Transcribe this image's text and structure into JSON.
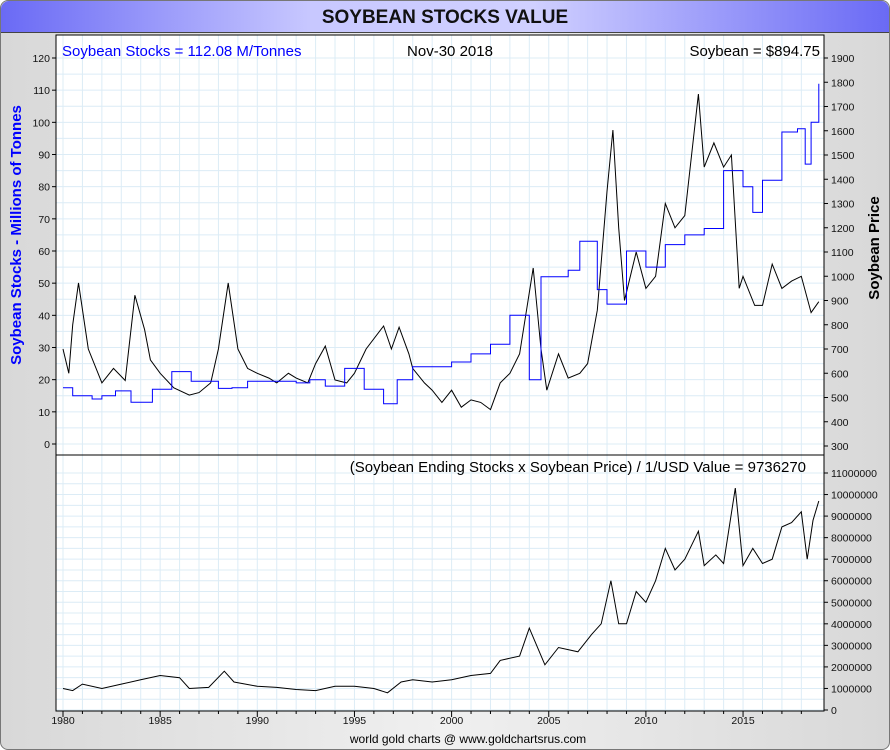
{
  "title": "SOYBEAN STOCKS VALUE",
  "footer": "world gold charts @ www.goldchartsrus.com",
  "colors": {
    "stocks": "#0000ff",
    "price": "#000000",
    "value": "#000000",
    "grid": "#dcecf6"
  },
  "chart_data": [
    {
      "type": "line",
      "panel": "top",
      "labels": {
        "left_title": "Soybean Stocks = 112.08 M/Tonnes",
        "center": "Nov-30  2018",
        "right_title": "Soybean = $894.75"
      },
      "ylabel": "Soybean Stocks - Millions of Tonnes",
      "y2label": "Soybean Price",
      "ylim": [
        0,
        120
      ],
      "y2lim": [
        300,
        1900
      ],
      "xlim": [
        1980,
        2018.9
      ],
      "yticks": [
        0,
        10,
        20,
        30,
        40,
        50,
        60,
        70,
        80,
        90,
        100,
        110,
        120
      ],
      "y2ticks": [
        300,
        400,
        500,
        600,
        700,
        800,
        900,
        1000,
        1100,
        1200,
        1300,
        1400,
        1500,
        1600,
        1700,
        1800,
        1900
      ],
      "series": [
        {
          "name": "Soybean Stocks",
          "axis": "left",
          "step": true,
          "points": [
            [
              1980,
              17.5
            ],
            [
              1980.5,
              15
            ],
            [
              1981.5,
              14
            ],
            [
              1982,
              15
            ],
            [
              1982.7,
              16.5
            ],
            [
              1983.5,
              13
            ],
            [
              1984.6,
              17
            ],
            [
              1985.6,
              22.5
            ],
            [
              1986.6,
              19.5
            ],
            [
              1988,
              17.3
            ],
            [
              1988.7,
              17.5
            ],
            [
              1989.5,
              19.5
            ],
            [
              1992,
              19
            ],
            [
              1992.7,
              20
            ],
            [
              1993.5,
              18
            ],
            [
              1994.5,
              23.5
            ],
            [
              1995.5,
              17
            ],
            [
              1996.5,
              12.5
            ],
            [
              1997.2,
              20
            ],
            [
              1998,
              24
            ],
            [
              2000,
              25.5
            ],
            [
              2001,
              28
            ],
            [
              2002,
              31
            ],
            [
              2003,
              40
            ],
            [
              2004,
              20
            ],
            [
              2004.6,
              52
            ],
            [
              2006,
              54
            ],
            [
              2006.6,
              63
            ],
            [
              2007.5,
              48
            ],
            [
              2008,
              43.5
            ],
            [
              2009,
              60
            ],
            [
              2010,
              55
            ],
            [
              2011,
              62
            ],
            [
              2012,
              65
            ],
            [
              2013,
              67
            ],
            [
              2014,
              85
            ],
            [
              2015,
              80
            ],
            [
              2015.5,
              72
            ],
            [
              2016,
              82
            ],
            [
              2017,
              97
            ],
            [
              2017.8,
              98
            ],
            [
              2018.2,
              87
            ],
            [
              2018.5,
              100
            ],
            [
              2018.9,
              112
            ]
          ]
        },
        {
          "name": "Soybean Price",
          "axis": "right",
          "points": [
            [
              1980,
              700
            ],
            [
              1980.3,
              600
            ],
            [
              1980.5,
              800
            ],
            [
              1980.8,
              972
            ],
            [
              1981.3,
              700
            ],
            [
              1982,
              560
            ],
            [
              1982.6,
              620
            ],
            [
              1983.2,
              570
            ],
            [
              1983.7,
              922
            ],
            [
              1984.2,
              780
            ],
            [
              1984.5,
              655
            ],
            [
              1985,
              600
            ],
            [
              1985.7,
              540
            ],
            [
              1986.5,
              510
            ],
            [
              1987,
              520
            ],
            [
              1987.6,
              560
            ],
            [
              1988,
              700
            ],
            [
              1988.5,
              972
            ],
            [
              1989,
              700
            ],
            [
              1989.5,
              620
            ],
            [
              1990,
              600
            ],
            [
              1990.6,
              580
            ],
            [
              1991,
              560
            ],
            [
              1991.6,
              600
            ],
            [
              1992,
              580
            ],
            [
              1992.6,
              560
            ],
            [
              1993,
              640
            ],
            [
              1993.5,
              712
            ],
            [
              1994,
              572
            ],
            [
              1994.6,
              560
            ],
            [
              1995,
              600
            ],
            [
              1995.6,
              700
            ],
            [
              1996.5,
              795
            ],
            [
              1996.9,
              700
            ],
            [
              1997.3,
              790
            ],
            [
              1997.8,
              680
            ],
            [
              1998,
              620
            ],
            [
              1998.6,
              560
            ],
            [
              1999,
              530
            ],
            [
              1999.5,
              480
            ],
            [
              2000,
              530
            ],
            [
              2000.5,
              460
            ],
            [
              2001,
              490
            ],
            [
              2001.5,
              480
            ],
            [
              2002,
              450
            ],
            [
              2002.5,
              560
            ],
            [
              2003,
              600
            ],
            [
              2003.5,
              680
            ],
            [
              2004.2,
              1034
            ],
            [
              2004.6,
              700
            ],
            [
              2004.9,
              530
            ],
            [
              2005.5,
              680
            ],
            [
              2006,
              580
            ],
            [
              2006.6,
              600
            ],
            [
              2007,
              640
            ],
            [
              2007.5,
              860
            ],
            [
              2008,
              1350
            ],
            [
              2008.3,
              1603
            ],
            [
              2008.6,
              1200
            ],
            [
              2008.9,
              900
            ],
            [
              2009.5,
              1100
            ],
            [
              2010,
              950
            ],
            [
              2010.5,
              1000
            ],
            [
              2011,
              1300
            ],
            [
              2011.5,
              1200
            ],
            [
              2012,
              1250
            ],
            [
              2012.7,
              1751
            ],
            [
              2013,
              1450
            ],
            [
              2013.5,
              1550
            ],
            [
              2014,
              1450
            ],
            [
              2014.4,
              1500
            ],
            [
              2014.8,
              950
            ],
            [
              2015,
              1000
            ],
            [
              2015.6,
              880
            ],
            [
              2016,
              880
            ],
            [
              2016.5,
              1050
            ],
            [
              2017,
              950
            ],
            [
              2017.5,
              980
            ],
            [
              2018,
              1000
            ],
            [
              2018.5,
              850
            ],
            [
              2018.9,
              895
            ]
          ]
        }
      ]
    },
    {
      "type": "line",
      "panel": "bottom",
      "title": "(Soybean Ending Stocks x Soybean Price) / 1/USD  Value = 9736270",
      "ylim": [
        0,
        11000000
      ],
      "yticks": [
        0,
        1000000,
        2000000,
        3000000,
        4000000,
        5000000,
        6000000,
        7000000,
        8000000,
        9000000,
        10000000,
        11000000
      ],
      "xticks": [
        1980,
        1985,
        1990,
        1995,
        2000,
        2005,
        2010,
        2015
      ],
      "series": [
        {
          "name": "Value",
          "points": [
            [
              1980,
              1000000
            ],
            [
              1980.5,
              900000
            ],
            [
              1981,
              1200000
            ],
            [
              1982,
              1000000
            ],
            [
              1983,
              1200000
            ],
            [
              1984,
              1400000
            ],
            [
              1985,
              1600000
            ],
            [
              1986,
              1500000
            ],
            [
              1986.5,
              1000000
            ],
            [
              1987.5,
              1050000
            ],
            [
              1988.3,
              1800000
            ],
            [
              1988.8,
              1300000
            ],
            [
              1990,
              1100000
            ],
            [
              1991,
              1050000
            ],
            [
              1992,
              950000
            ],
            [
              1993,
              900000
            ],
            [
              1994,
              1100000
            ],
            [
              1995,
              1100000
            ],
            [
              1996,
              1000000
            ],
            [
              1996.7,
              800000
            ],
            [
              1997.4,
              1300000
            ],
            [
              1998,
              1400000
            ],
            [
              1999,
              1300000
            ],
            [
              2000,
              1400000
            ],
            [
              2001,
              1600000
            ],
            [
              2002,
              1700000
            ],
            [
              2002.5,
              2300000
            ],
            [
              2003.5,
              2500000
            ],
            [
              2004,
              3800000
            ],
            [
              2004.8,
              2100000
            ],
            [
              2005.5,
              2900000
            ],
            [
              2006.5,
              2700000
            ],
            [
              2007.2,
              3500000
            ],
            [
              2007.7,
              4000000
            ],
            [
              2008.2,
              6000000
            ],
            [
              2008.6,
              4000000
            ],
            [
              2009,
              4000000
            ],
            [
              2009.5,
              5500000
            ],
            [
              2010,
              5000000
            ],
            [
              2010.5,
              6000000
            ],
            [
              2011,
              7500000
            ],
            [
              2011.5,
              6500000
            ],
            [
              2012,
              7000000
            ],
            [
              2012.7,
              8300000
            ],
            [
              2013,
              6700000
            ],
            [
              2013.6,
              7200000
            ],
            [
              2014,
              6800000
            ],
            [
              2014.6,
              10300000
            ],
            [
              2015,
              6700000
            ],
            [
              2015.5,
              7500000
            ],
            [
              2016,
              6800000
            ],
            [
              2016.5,
              7000000
            ],
            [
              2017,
              8500000
            ],
            [
              2017.5,
              8700000
            ],
            [
              2018,
              9200000
            ],
            [
              2018.3,
              7000000
            ],
            [
              2018.6,
              8800000
            ],
            [
              2018.9,
              9700000
            ]
          ]
        }
      ]
    }
  ]
}
